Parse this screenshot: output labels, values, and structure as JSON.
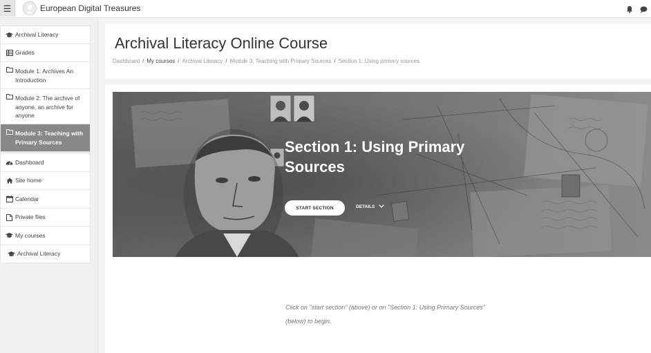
{
  "navbar": {
    "menu_icon": "hamburger-icon",
    "site_name": "European Digital Treasures",
    "icons": [
      "bell-icon",
      "chat-icon"
    ]
  },
  "sidebar": {
    "items": [
      {
        "label": "Archival Literacy",
        "icon": "graduation-cap-icon"
      },
      {
        "label": "Grades",
        "icon": "table-icon"
      },
      {
        "label": "Module 1: Archives An Introduction",
        "icon": "folder-icon"
      },
      {
        "label": "Module 2: The archive of anyone, an archive for anyone",
        "icon": "folder-icon"
      },
      {
        "label": "Module 3: Teaching with Primary Sources",
        "icon": "folder-icon",
        "active": true
      }
    ],
    "nav": [
      {
        "label": "Dashboard",
        "icon": "dashboard-icon"
      },
      {
        "label": "Site home",
        "icon": "home-icon"
      },
      {
        "label": "Calendar",
        "icon": "calendar-icon"
      },
      {
        "label": "Private files",
        "icon": "file-icon"
      },
      {
        "label": "My courses",
        "icon": "graduation-cap-icon"
      },
      {
        "label": "Archival Literacy",
        "icon": "graduation-cap-icon"
      }
    ]
  },
  "header": {
    "title": "Archival Literacy Online Course",
    "breadcrumb": [
      "Dashboard",
      "My courses",
      "Archival Literacy",
      "Module 3: Teaching with Primary Sources",
      "Section 1: Using primary sources"
    ],
    "separator": "/"
  },
  "hero": {
    "title_line1": "Section 1: Using Primary",
    "title_line2": "Sources",
    "start_label": "START SECTION",
    "details_label": "DETAILS"
  },
  "instructions": {
    "line1": "Click on \"start section\" (above) or on \"Section 1: Using Primary Sources\"",
    "line2": "(below) to begin."
  },
  "colors": {
    "active_item": "#888888",
    "page_bg": "#f4f4f4"
  }
}
